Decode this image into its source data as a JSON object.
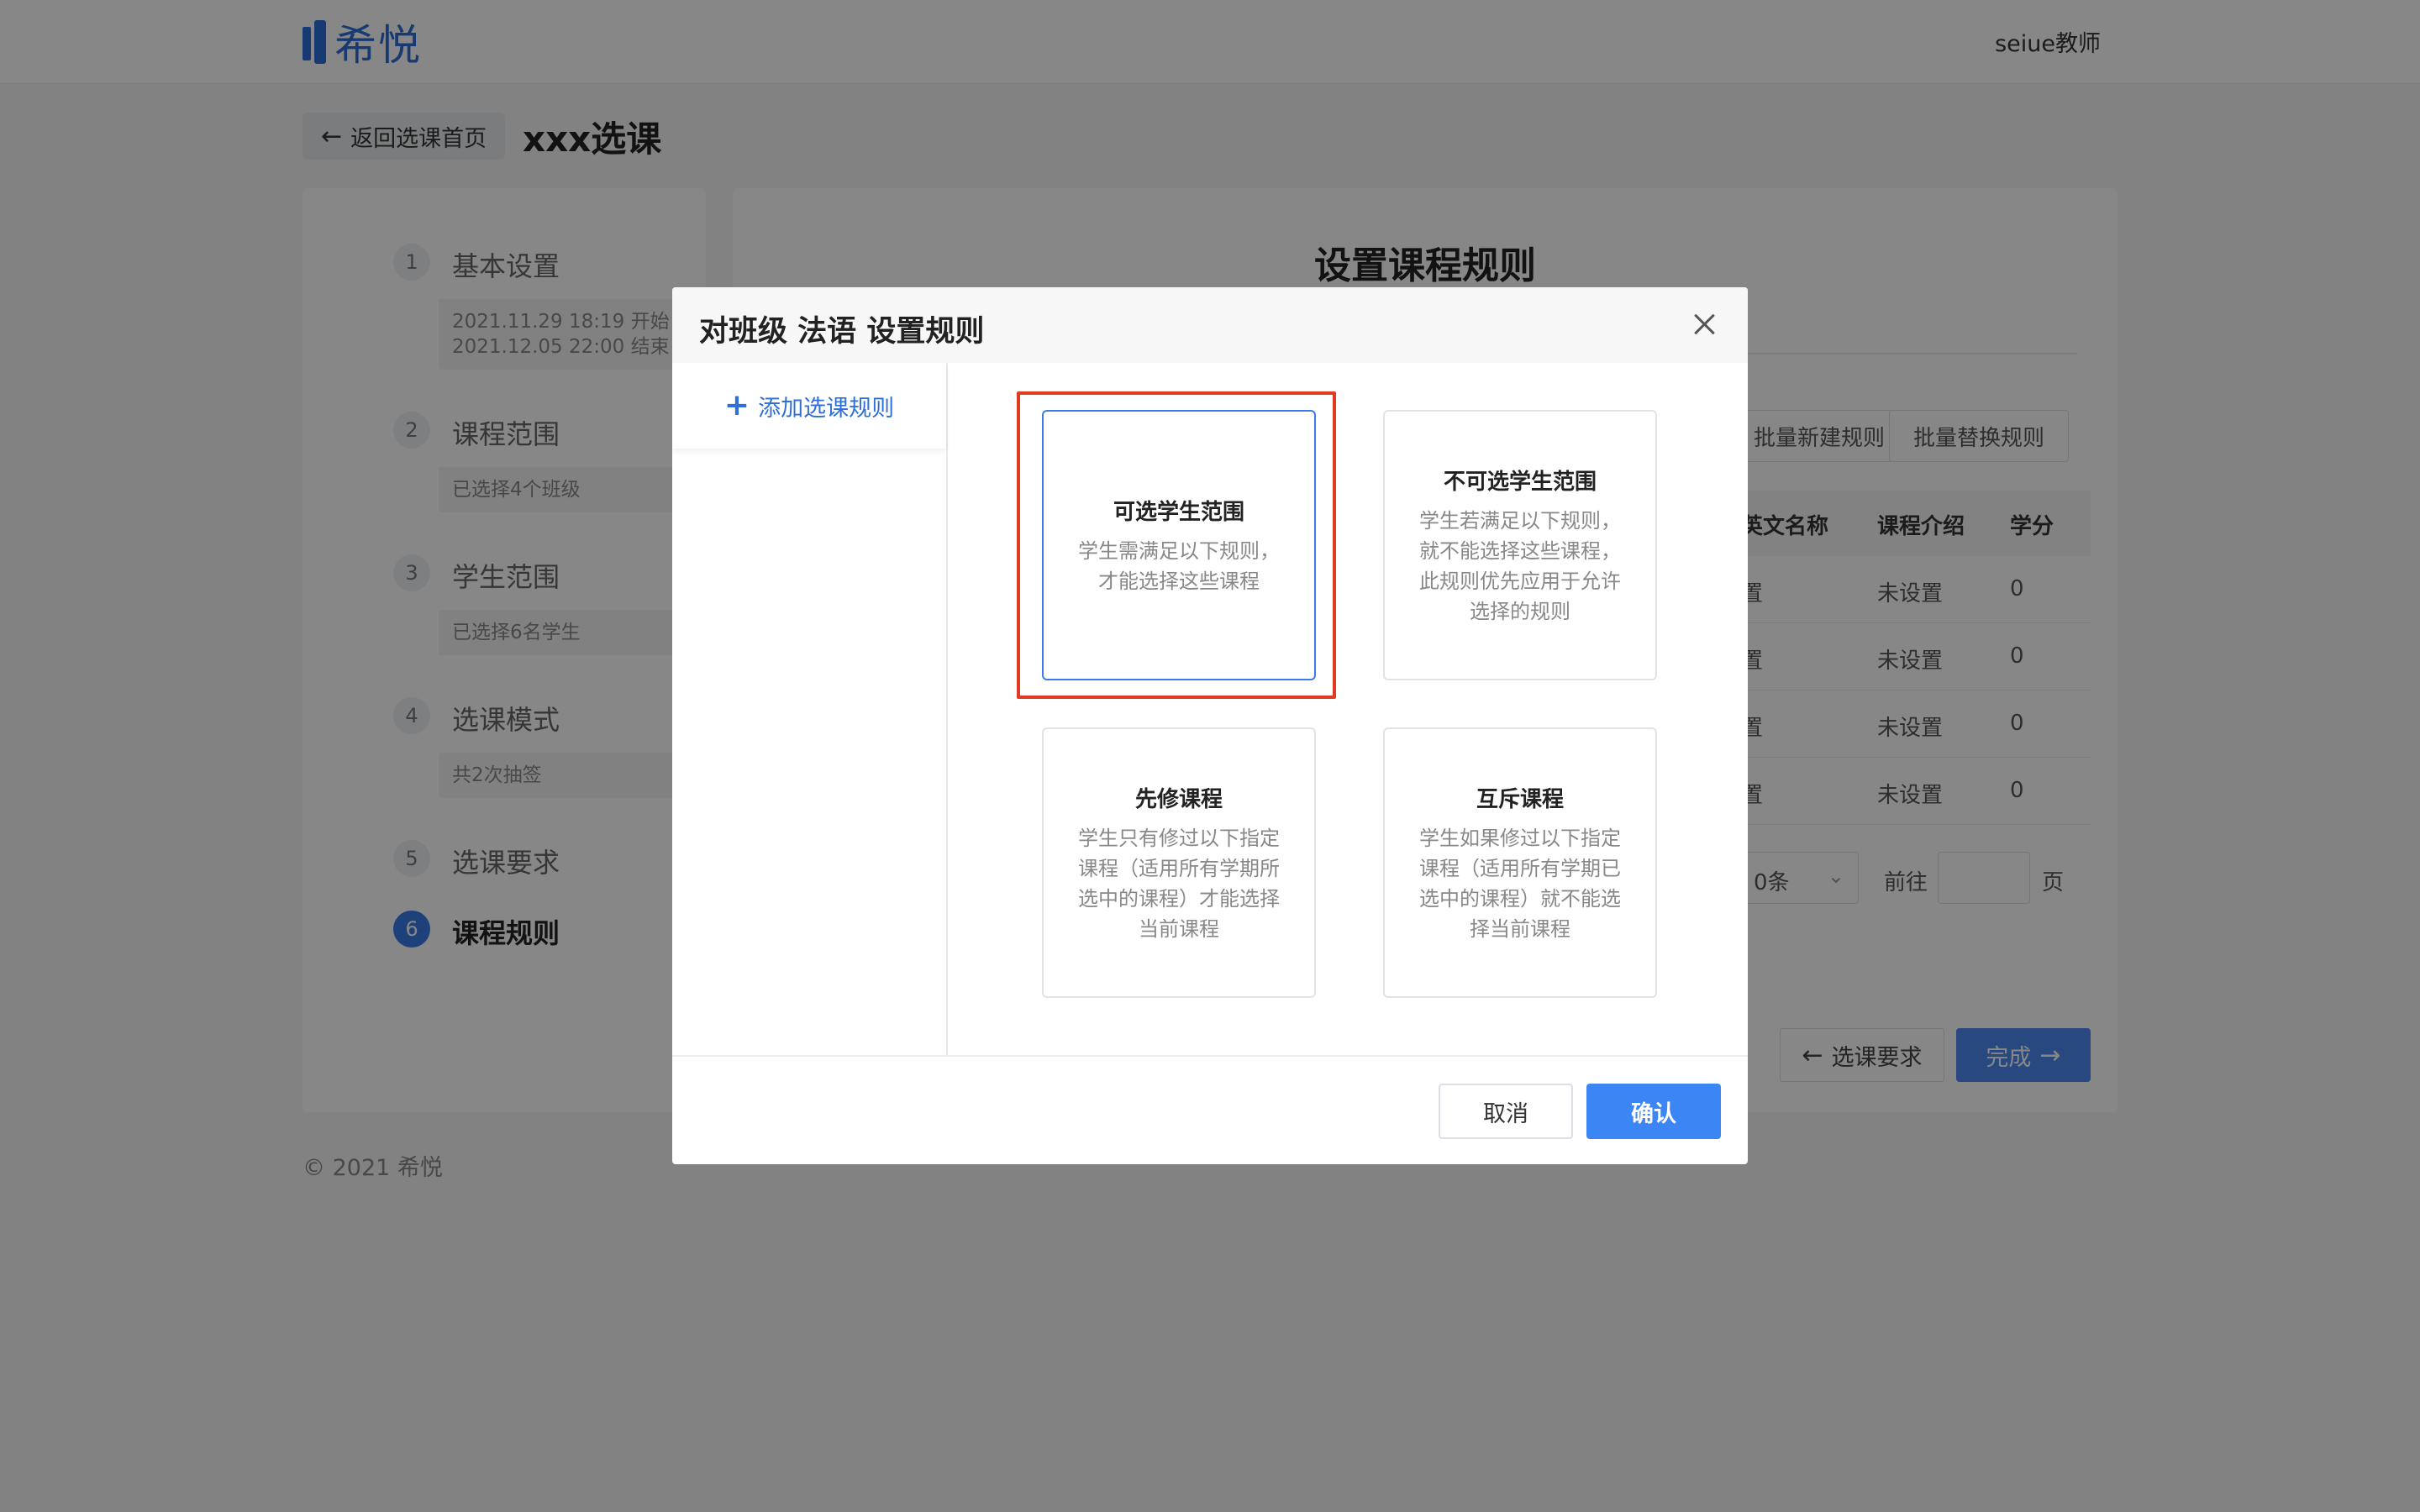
{
  "topbar": {
    "logo_text": "希悦",
    "user_name": "seiue教师"
  },
  "header": {
    "back_label": "返回选课首页",
    "page_title": "xxx选课"
  },
  "steps": [
    {
      "num": "1",
      "label": "基本设置",
      "detail_line1": "2021.11.29 18:19 开始",
      "detail_line2": "2021.12.05 22:00 结束"
    },
    {
      "num": "2",
      "label": "课程范围",
      "detail": "已选择4个班级"
    },
    {
      "num": "3",
      "label": "学生范围",
      "detail": "已选择6名学生"
    },
    {
      "num": "4",
      "label": "选课模式",
      "detail": "共2次抽签"
    },
    {
      "num": "5",
      "label": "选课要求"
    },
    {
      "num": "6",
      "label": "课程规则"
    }
  ],
  "main": {
    "title": "设置课程规则",
    "batch_new_label": "批量新建规则",
    "batch_replace_label": "批量替换规则",
    "columns": [
      "英文名称",
      "课程介绍",
      "学分"
    ],
    "rows": [
      {
        "english": "置",
        "intro": "未设置",
        "credit": "0"
      },
      {
        "english": "置",
        "intro": "未设置",
        "credit": "0"
      },
      {
        "english": "置",
        "intro": "未设置",
        "credit": "0"
      },
      {
        "english": "置",
        "intro": "未设置",
        "credit": "0"
      }
    ],
    "page_size_label": "0条",
    "goto_label": "前往",
    "page_label": "页",
    "prev_label": "选课要求",
    "done_label": "完成"
  },
  "footer": {
    "copyright": "© 2021 希悦"
  },
  "modal": {
    "title": "对班级 法语 设置规则",
    "add_rule_label": "添加选课规则",
    "cancel_label": "取消",
    "confirm_label": "确认",
    "rule_options": [
      {
        "title": "可选学生范围",
        "desc": "学生需满足以下规则，才能选择这些课程",
        "selected": true
      },
      {
        "title": "不可选学生范围",
        "desc": "学生若满足以下规则，就不能选择这些课程，此规则优先应用于允许选择的规则",
        "selected": false
      },
      {
        "title": "先修课程",
        "desc": "学生只有修过以下指定课程（适用所有学期所选中的课程）才能选择当前课程",
        "selected": false
      },
      {
        "title": "互斥课程",
        "desc": "学生如果修过以下指定课程（适用所有学期已选中的课程）就不能选择当前课程",
        "selected": false
      }
    ]
  },
  "colors": {
    "accent": "#3b7be8",
    "highlight": "#e03a22",
    "overlay": "rgba(0,0,0,0.47)"
  }
}
